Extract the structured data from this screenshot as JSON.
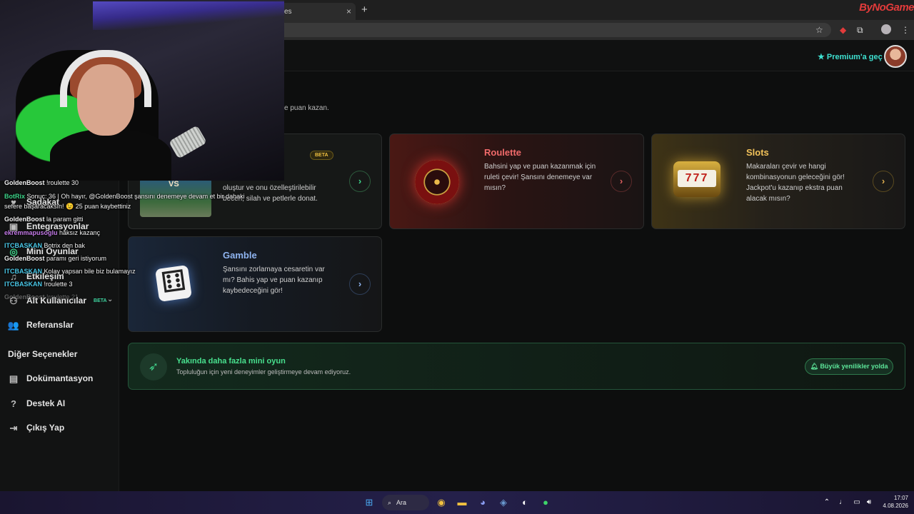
{
  "browser": {
    "tab_suffix": "es",
    "tab_close": "×",
    "new_tab": "+",
    "brand": "ByNoGame",
    "icons": [
      "star-icon",
      "extension-icon",
      "puzzle-icon",
      "profile-icon",
      "menu-icon"
    ]
  },
  "header": {
    "premium_label": "Premium'a geç",
    "premium_color": "#3ee0d0"
  },
  "sidebar": {
    "items": [
      {
        "label": "Sadakat",
        "icon": "loyalty-icon"
      },
      {
        "label": "Entegrasyonlar",
        "icon": "integrations-icon"
      },
      {
        "label": "Mini Oyunlar",
        "icon": "games-icon"
      },
      {
        "label": "Etkileşim",
        "icon": "music-icon"
      },
      {
        "label": "Alt Kullanıcılar",
        "icon": "sub-users-icon",
        "badge": "BETA"
      },
      {
        "label": "Referanslar",
        "icon": "referrals-icon"
      }
    ],
    "other_heading": "Diğer Seçenekler",
    "other_items": [
      {
        "label": "Dokümantasyon",
        "icon": "docs-icon"
      },
      {
        "label": "Destek AI",
        "icon": "help-icon"
      },
      {
        "label": "Çıkış Yap",
        "icon": "logout-icon"
      }
    ]
  },
  "main": {
    "subtitle": "e puan kazan.",
    "cards": [
      {
        "id": "battle",
        "title": "",
        "badge": "BETA",
        "description": "ası savaşlarda\nersiz bir karakter\noluştur ve onu özelleştirilebilir\nbeceri, silah ve petlerle donat."
      },
      {
        "id": "roulette",
        "title": "Roulette",
        "title_color": "#f06a6a",
        "description": "Bahsini yap ve puan kazanmak için\nruleti çevir! Şansını denemeye var\nmısın?"
      },
      {
        "id": "slots",
        "title": "Slots",
        "title_color": "#f2c25a",
        "description": "Makaraları çevir ve hangi\nkombinasyonun geleceğini gör!\nJackpot'u kazanıp ekstra puan\nalacak mısın?"
      },
      {
        "id": "gamble",
        "title": "Gamble",
        "title_color": "#8fb4f0",
        "description": "Şansını zorlamaya cesaretin var\nmı? Bahis yap ve puan kazanıp\nkaybedeceğini gör!"
      }
    ],
    "arrow_glyph": "›",
    "banner": {
      "title": "Yakında daha fazla mini oyun",
      "subtitle": "Topluluğun için yeni deneyimler geliştirmeye devam ediyoruz.",
      "pill": "Büyük yenilikler yolda",
      "accent": "#48e08e"
    }
  },
  "chat": [
    {
      "user": "GoldenBoost",
      "text": "!roulette 30"
    },
    {
      "user": "BotRix",
      "text": "Sonuç: 36 | Oh hayır, @GoldenBoost şansını denemeye devam et bir dahaki"
    },
    {
      "user": "",
      "text": "sefere başaracaksın! 😉 25 puan kaybettiniz"
    },
    {
      "user": "GoldenBoost",
      "text": "la param gitti"
    },
    {
      "user": "ekremmapusoglu",
      "text": "haksız kazanç"
    },
    {
      "user": "ITCBASKAN",
      "text": "Botrix den bak"
    },
    {
      "user": "GoldenBoost",
      "text": "paramı geri istiyorum"
    },
    {
      "user": "ITCBASKAN",
      "text": "Kolay yapsan bile biz bulamayız"
    },
    {
      "user": "ITCBASKAN",
      "text": "!roulette 3"
    },
    {
      "user": "GoldenBoost",
      "text": "!roulette 21"
    }
  ],
  "taskbar": {
    "search_label": "Ara",
    "time": "17:07",
    "date": "4.08.2026"
  }
}
